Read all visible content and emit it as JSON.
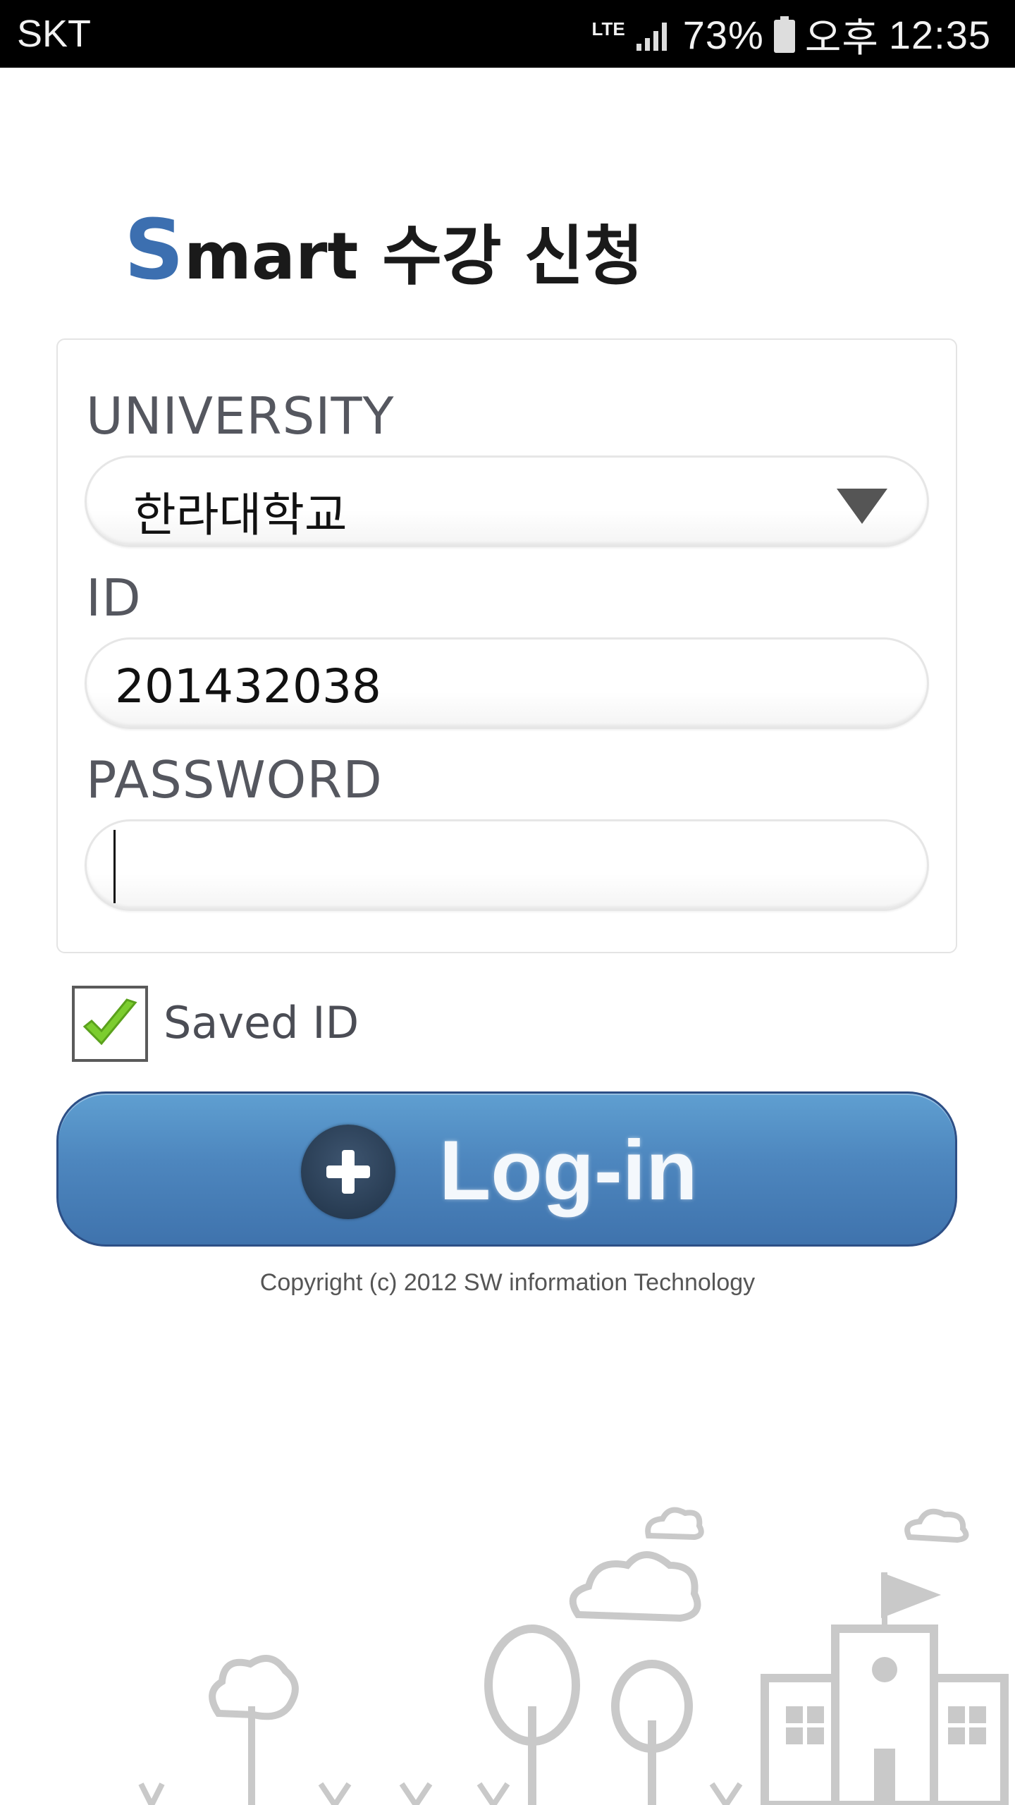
{
  "status_bar": {
    "carrier": "SKT",
    "network": "LTE",
    "battery": "73%",
    "ampm": "오후",
    "time": "12:35"
  },
  "logo": {
    "s_letter": "S",
    "mart": "mart",
    "korean": "수강 신청",
    "accent_color": "#3c6fb0"
  },
  "form": {
    "university_label": "UNIVERSITY",
    "university_value": "한라대학교",
    "id_label": "ID",
    "id_value": "201432038",
    "password_label": "PASSWORD",
    "password_value": ""
  },
  "saved_id": {
    "label": "Saved ID",
    "checked": true
  },
  "login_button": {
    "label": "Log-in",
    "color": "#4d86be"
  },
  "footer": {
    "copyright": "Copyright (c) 2012 SW information Technology"
  }
}
